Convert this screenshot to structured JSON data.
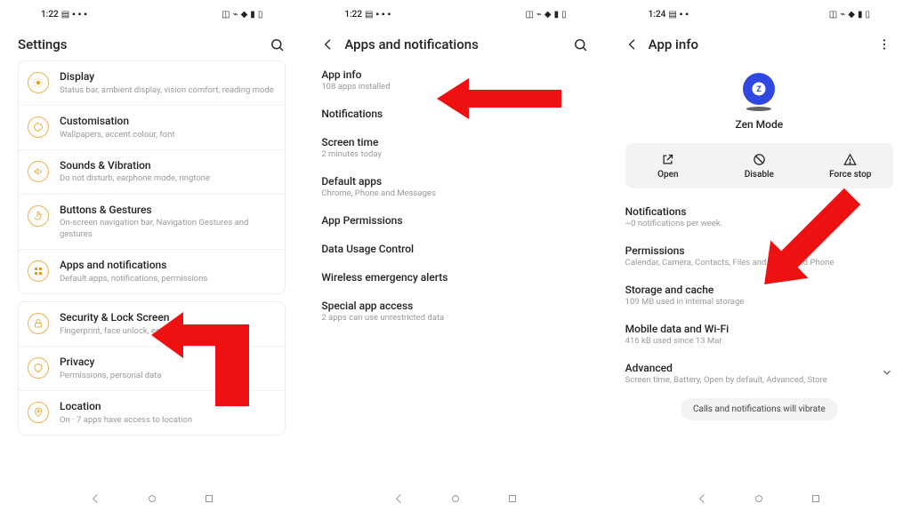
{
  "status": {
    "s1": {
      "time": "1:22"
    },
    "s2": {
      "time": "1:22"
    },
    "s3": {
      "time": "1:24"
    }
  },
  "screen1": {
    "title": "Settings",
    "group1": [
      {
        "title": "Display",
        "sub": "Status bar, ambient display, vision comfort, reading mode"
      },
      {
        "title": "Customisation",
        "sub": "Wallpapers, accent colour, font"
      },
      {
        "title": "Sounds & Vibration",
        "sub": "Do not disturb, earphone mode, ringtone"
      },
      {
        "title": "Buttons & Gestures",
        "sub": "On-screen navigation bar, Navigation Gestures and gestures"
      },
      {
        "title": "Apps and notifications",
        "sub": "Default apps, notifications, permissions"
      }
    ],
    "group2": [
      {
        "title": "Security & Lock Screen",
        "sub": "Fingerprint, face unlock, emergency rescue"
      },
      {
        "title": "Privacy",
        "sub": "Permissions, personal data"
      },
      {
        "title": "Location",
        "sub": "On · 7 apps have access to location"
      }
    ]
  },
  "screen2": {
    "title": "Apps and notifications",
    "rows": [
      {
        "title": "App info",
        "sub": "108 apps installed"
      },
      {
        "title": "Notifications",
        "sub": ""
      },
      {
        "title": "Screen time",
        "sub": "2 minutes today"
      },
      {
        "title": "Default apps",
        "sub": "Chrome, Phone and Messages"
      },
      {
        "title": "App Permissions",
        "sub": ""
      },
      {
        "title": "Data Usage Control",
        "sub": ""
      },
      {
        "title": "Wireless emergency alerts",
        "sub": ""
      },
      {
        "title": "Special app access",
        "sub": "2 apps can use unrestricted data"
      }
    ]
  },
  "screen3": {
    "title": "App info",
    "app_name": "Zen Mode",
    "actions": {
      "open": "Open",
      "disable": "Disable",
      "force_stop": "Force stop"
    },
    "rows": [
      {
        "title": "Notifications",
        "sub": "~0 notifications per week."
      },
      {
        "title": "Permissions",
        "sub": "Calendar, Camera, Contacts, Files and media and Phone"
      },
      {
        "title": "Storage and cache",
        "sub": "109 MB used in internal storage"
      },
      {
        "title": "Mobile data and Wi-Fi",
        "sub": "416 kB used since 13 Mar"
      },
      {
        "title": "Advanced",
        "sub": "Screen time, Battery, Open by default, Advanced, Store"
      }
    ],
    "pill": "Calls and notifications will vibrate"
  }
}
